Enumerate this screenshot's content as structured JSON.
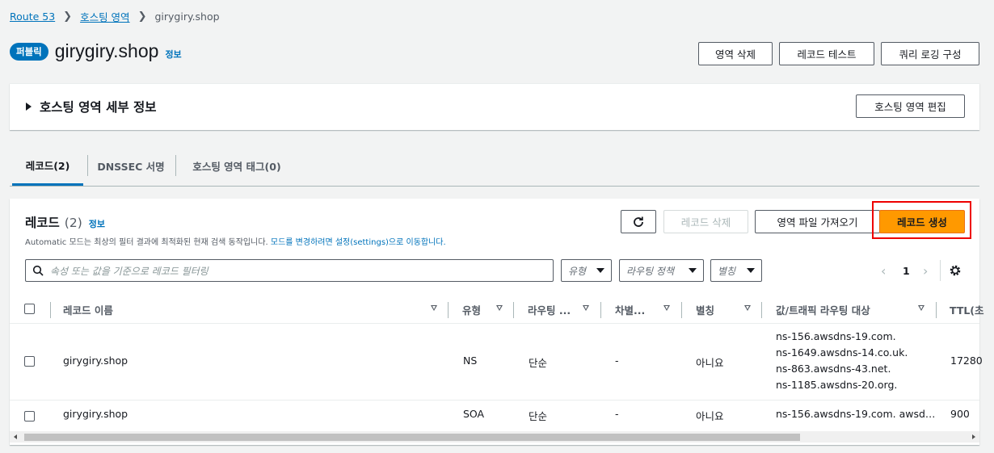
{
  "breadcrumb": {
    "root": "Route 53",
    "hosted_zones": "호스팅 영역",
    "current": "girygiry.shop"
  },
  "header": {
    "badge": "퍼블릭",
    "title": "girygiry.shop",
    "info": "정보",
    "buttons": {
      "delete_zone": "영역 삭제",
      "test_record": "레코드 테스트",
      "query_logging": "쿼리 로깅 구성"
    }
  },
  "details": {
    "title": "호스팅 영역 세부 정보",
    "edit_button": "호스팅 영역 편집"
  },
  "tabs": [
    {
      "label": "레코드(2)",
      "active": true
    },
    {
      "label": "DNSSEC 서명",
      "active": false
    },
    {
      "label": "호스팅 영역 태그(0)",
      "active": false
    }
  ],
  "records": {
    "title": "레코드",
    "count": "(2)",
    "info": "정보",
    "description_prefix": "Automatic 모드는 최상의 필터 결과에 최적화된 현재 검색 동작입니다.",
    "description_link": "모드를 변경하려면 설정(settings)으로 이동합니다.",
    "buttons": {
      "delete": "레코드 삭제",
      "import": "영역 파일 가져오기",
      "create": "레코드 생성"
    },
    "search_placeholder": "속성 또는 값을 기준으로 레코드 필터링",
    "filters": {
      "type": "유형",
      "routing": "라우팅 정책",
      "alias": "별칭"
    },
    "pagination": {
      "page": "1"
    },
    "columns": {
      "name": "레코드 이름",
      "type": "유형",
      "routing": "라우팅 ...",
      "differentiator": "차별...",
      "alias": "별칭",
      "value": "값/트래픽 라우팅 대상",
      "ttl": "TTL(초"
    },
    "rows": [
      {
        "name": "girygiry.shop",
        "type": "NS",
        "routing": "단순",
        "differentiator": "-",
        "alias": "아니요",
        "values": [
          "ns-156.awsdns-19.com.",
          "ns-1649.awsdns-14.co.uk.",
          "ns-863.awsdns-43.net.",
          "ns-1185.awsdns-20.org."
        ],
        "ttl": "17280"
      },
      {
        "name": "girygiry.shop",
        "type": "SOA",
        "routing": "단순",
        "differentiator": "-",
        "alias": "아니요",
        "values": [
          "ns-156.awsdns-19.com. awsd…"
        ],
        "ttl": "900"
      }
    ]
  }
}
